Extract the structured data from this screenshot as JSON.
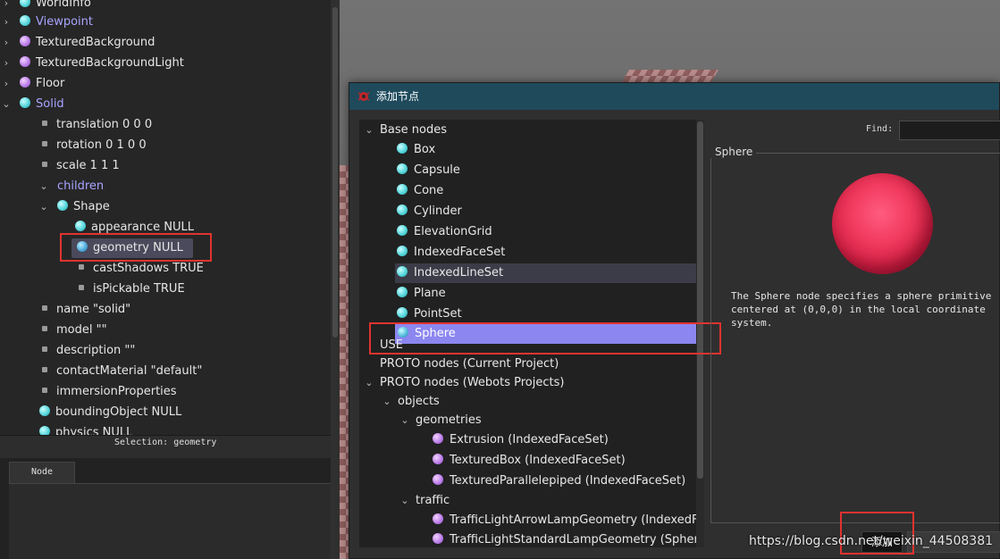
{
  "scene_tree": {
    "rows": [
      {
        "text": "WorldInfo",
        "icon": "cyan"
      },
      {
        "text": "Viewpoint",
        "icon": "cyan"
      },
      {
        "text": "TexturedBackground",
        "icon": "purple"
      },
      {
        "text": "TexturedBackgroundLight",
        "icon": "purple"
      },
      {
        "text": "Floor",
        "icon": "purple"
      },
      {
        "text": "Solid",
        "icon": "cyan"
      },
      {
        "text": "translation 0 0 0"
      },
      {
        "text": "rotation 0 1 0 0"
      },
      {
        "text": "scale 1 1 1"
      },
      {
        "text": "children"
      },
      {
        "text": "Shape"
      },
      {
        "text": "appearance NULL"
      },
      {
        "text": "geometry NULL"
      },
      {
        "text": "castShadows TRUE"
      },
      {
        "text": "isPickable TRUE"
      },
      {
        "text": "name \"solid\""
      },
      {
        "text": "model \"\""
      },
      {
        "text": "description \"\""
      },
      {
        "text": "contactMaterial \"default\""
      },
      {
        "text": "immersionProperties"
      },
      {
        "text": "boundingObject NULL"
      },
      {
        "text": "physics NULL"
      }
    ],
    "selection_text": "Selection: geometry",
    "node_tab": "Node"
  },
  "dialog": {
    "title": "添加节点",
    "find_label": "Find:",
    "find_value": "",
    "node_list": {
      "base_nodes_label": "Base nodes",
      "base_nodes": [
        "Box",
        "Capsule",
        "Cone",
        "Cylinder",
        "ElevationGrid",
        "IndexedFaceSet",
        "IndexedLineSet",
        "Plane",
        "PointSet",
        "Sphere"
      ],
      "use_label": "USE",
      "proto_current_label": "PROTO nodes (Current Project)",
      "proto_webots_label": "PROTO nodes (Webots Projects)",
      "objects_label": "objects",
      "geometries_label": "geometries",
      "geometries": [
        "Extrusion (IndexedFaceSet)",
        "TexturedBox (IndexedFaceSet)",
        "TexturedParallelepiped (IndexedFaceSet)"
      ],
      "traffic_label": "traffic",
      "traffic_items": [
        "TrafficLightArrowLampGeometry (IndexedFac…",
        "TrafficLightStandardLampGeometry (Sphere)"
      ]
    },
    "preview": {
      "title": "Sphere",
      "description": "The Sphere node specifies a sphere primitive\ncentered at (0,0,0) in the local coordinate\nsystem."
    },
    "add_label": "添加"
  },
  "watermark": "https://blog.csdn.net/weixin_44508381",
  "colors": {
    "titlebar": "#1e4a5c",
    "selection": "#8c86f0",
    "highlight_box": "#e0332f",
    "link_text": "#a9a4ff"
  }
}
